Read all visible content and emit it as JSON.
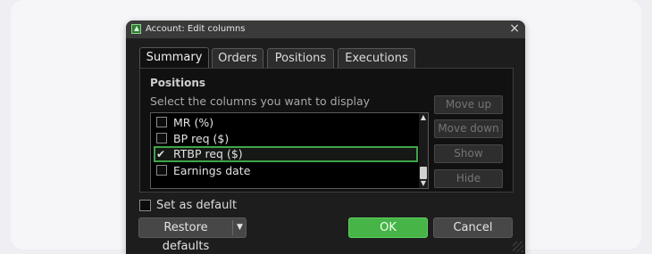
{
  "dialog": {
    "title": "Account: Edit columns",
    "close_label": "×"
  },
  "tabs": [
    {
      "label": "Summary",
      "active": true
    },
    {
      "label": "Orders",
      "active": false
    },
    {
      "label": "Positions",
      "active": false
    },
    {
      "label": "Executions",
      "active": false
    }
  ],
  "section": {
    "heading": "Positions",
    "instruction": "Select the columns you want to display"
  },
  "columns": [
    {
      "label": "MR (%)",
      "checked": false,
      "selected": false
    },
    {
      "label": "BP req ($)",
      "checked": false,
      "selected": false
    },
    {
      "label": "RTBP req ($)",
      "checked": true,
      "selected": true
    },
    {
      "label": "Earnings date",
      "checked": false,
      "selected": false
    }
  ],
  "side_buttons": {
    "move_up": "Move up",
    "move_down": "Move down",
    "show": "Show",
    "hide": "Hide"
  },
  "set_default": {
    "label": "Set as default",
    "checked": false
  },
  "buttons": {
    "restore_defaults": "Restore defaults",
    "ok": "OK",
    "cancel": "Cancel"
  },
  "colors": {
    "accent_green": "#46b446",
    "selection_border": "#3fa54a",
    "dialog_bg": "#1d1d1d"
  },
  "icons": {
    "check": "✔",
    "dropdown": "▼",
    "scroll_up": "▲",
    "scroll_down": "▼"
  }
}
